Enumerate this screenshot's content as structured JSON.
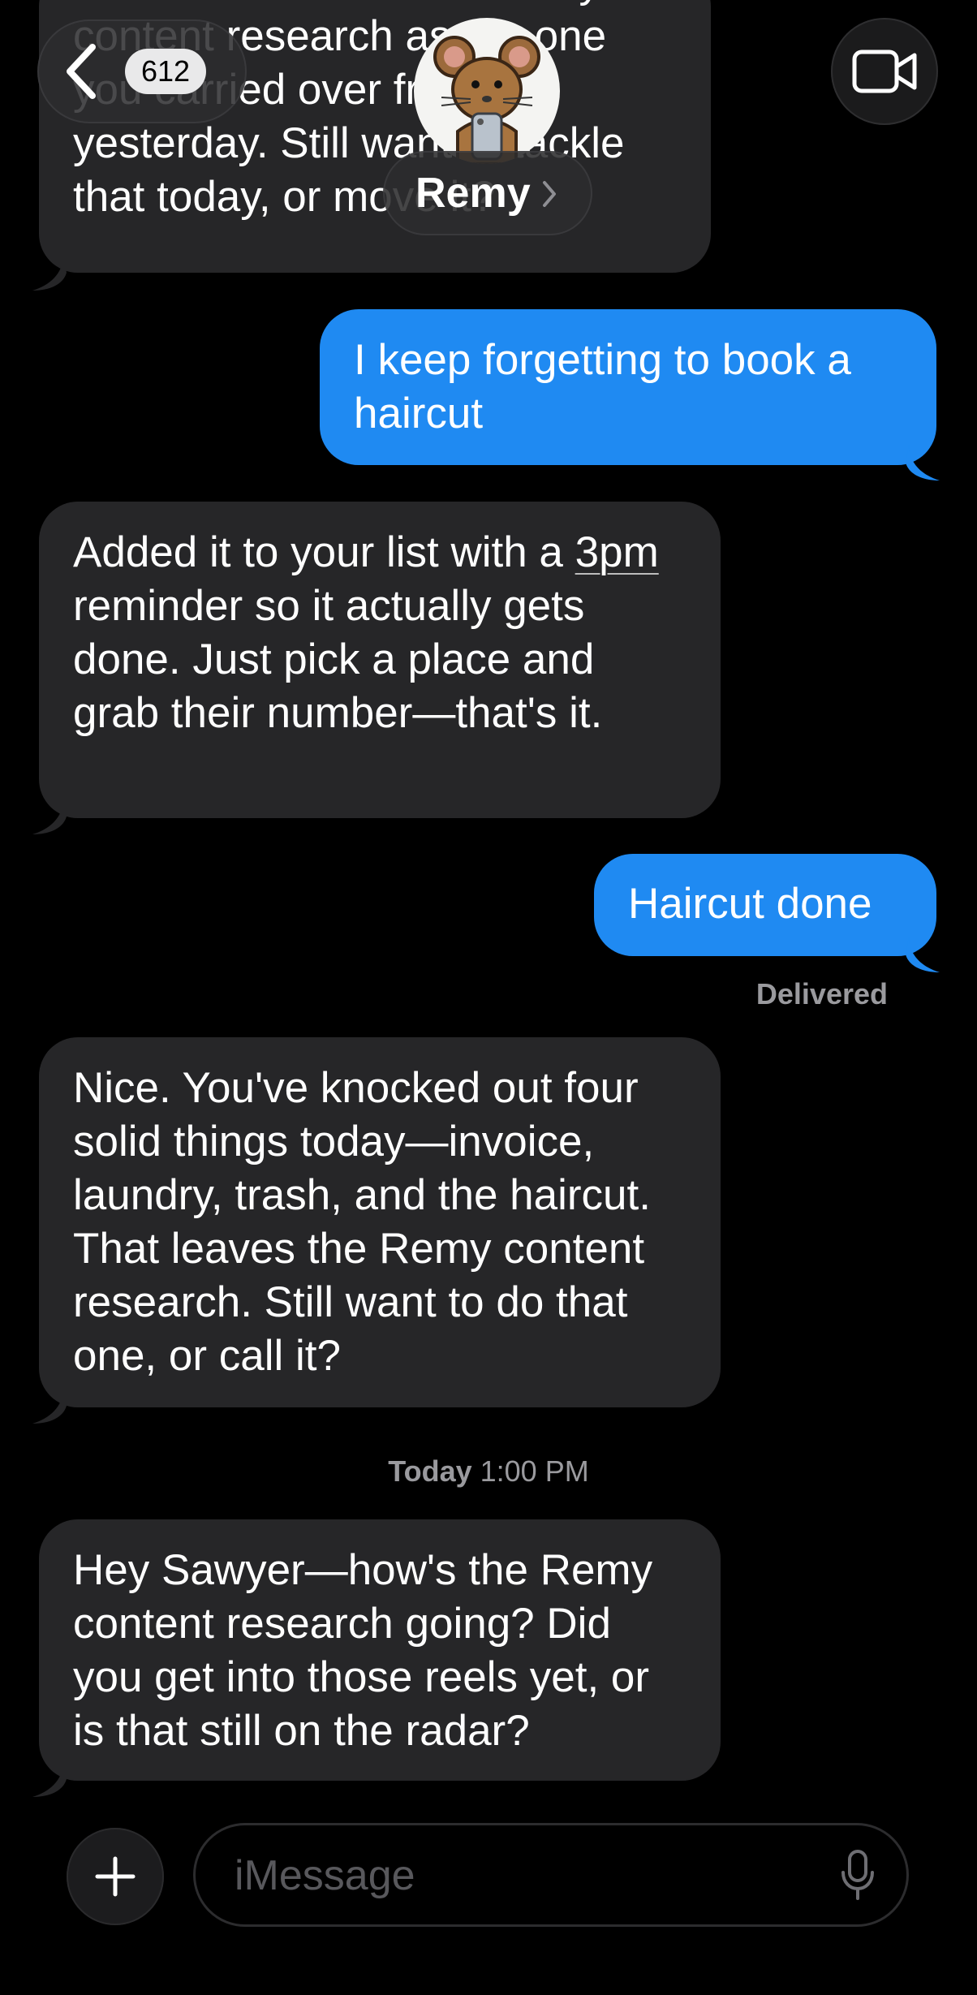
{
  "header": {
    "back_count": "612",
    "contact_name": "Remy"
  },
  "messages": [
    {
      "from": "contact",
      "text_lines": [
        "Nice. That leaves the Remy",
        "content research as the one",
        "you carried over from",
        "yesterday. Still want to tackle",
        "that today, or move it?"
      ]
    },
    {
      "from": "me",
      "text": "I keep forgetting to book a haircut"
    },
    {
      "from": "contact",
      "text_before": "Added it to your list with a ",
      "link": "3pm",
      "text_after": " reminder so it actually gets done. Just pick a place and grab their number—that's it."
    },
    {
      "from": "me",
      "text": "Haircut done"
    },
    {
      "from": "contact",
      "text": "Nice. You've knocked out four solid things today—invoice, laundry, trash, and the haircut. That leaves the Remy content research. Still want to do that one, or call it?"
    },
    {
      "from": "contact",
      "text": "Hey Sawyer—how's the Remy content research going? Did you get into those reels yet, or is that still on the radar?"
    }
  ],
  "status": {
    "delivered": "Delivered",
    "timestamp_day": "Today",
    "timestamp_time": "1:00 PM"
  },
  "input": {
    "placeholder": "iMessage"
  },
  "colors": {
    "outgoing_bubble": "#1f8af2",
    "incoming_bubble": "#262628",
    "background": "#000000"
  },
  "icons": [
    "back-chevron-icon",
    "video-camera-icon",
    "plus-icon",
    "microphone-icon",
    "mouse-avatar-icon",
    "chevron-right-icon"
  ]
}
